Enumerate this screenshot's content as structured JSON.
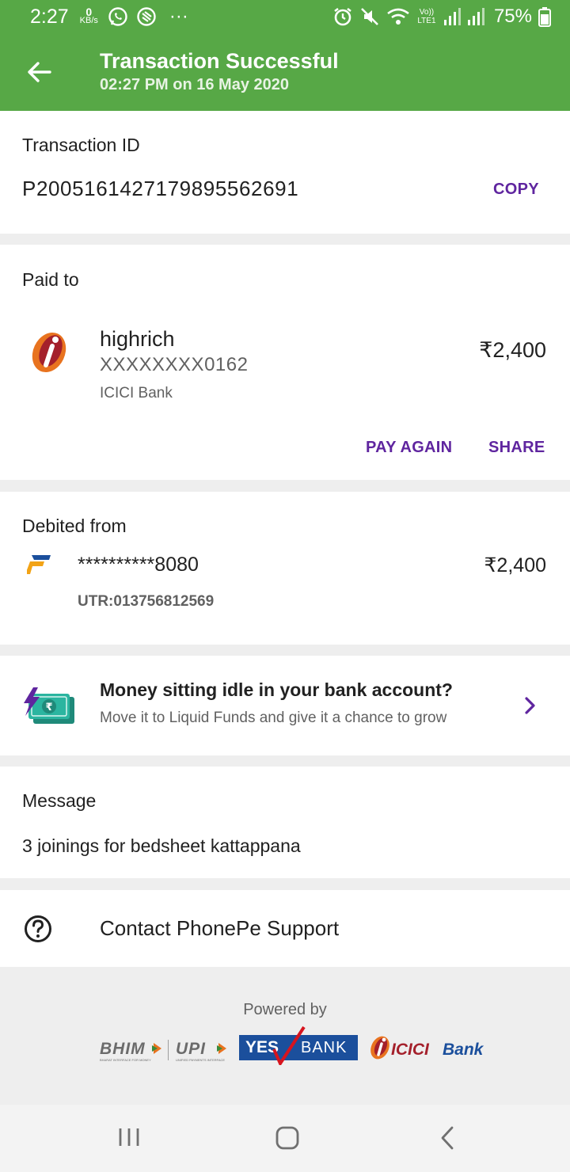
{
  "status_bar": {
    "time": "2:27",
    "net_speed_value": "0",
    "net_speed_unit": "KB/s",
    "more": "···",
    "lte_label": "Vo)) LTE1",
    "battery": "75%"
  },
  "header": {
    "title": "Transaction Successful",
    "subtitle": "02:27 PM on 16 May 2020"
  },
  "transaction": {
    "label": "Transaction ID",
    "id": "P2005161427179895562691",
    "copy_label": "COPY"
  },
  "paid_to": {
    "label": "Paid to",
    "name": "highrich",
    "account": "XXXXXXXX0162",
    "bank": "ICICI Bank",
    "amount": "₹2,400",
    "pay_again_label": "PAY AGAIN",
    "share_label": "SHARE"
  },
  "debited_from": {
    "label": "Debited from",
    "account": "**********8080",
    "amount": "₹2,400",
    "utr": "UTR:013756812569"
  },
  "promo": {
    "title": "Money sitting idle in your bank account?",
    "subtitle": "Move it to Liquid Funds and give it a chance to grow"
  },
  "message": {
    "label": "Message",
    "text": "3 joinings for bedsheet kattappana"
  },
  "support": {
    "label": "Contact PhonePe Support"
  },
  "footer": {
    "powered_by": "Powered by",
    "bhim": "BHIM",
    "bhim_tagline": "BHARAT INTERFACE FOR MONEY",
    "upi": "UPI",
    "upi_tagline": "UNIFIED PAYMENTS INTERFACE",
    "yes": "YES",
    "bank": "BANK",
    "icici": "ICICI",
    "icici_bank": "Bank"
  },
  "colors": {
    "header_green": "#57a846",
    "accent_purple": "#5f259f",
    "yes_bank_blue": "#1b4f9c",
    "icici_orange": "#e8731f",
    "icici_maroon": "#a4202b"
  }
}
